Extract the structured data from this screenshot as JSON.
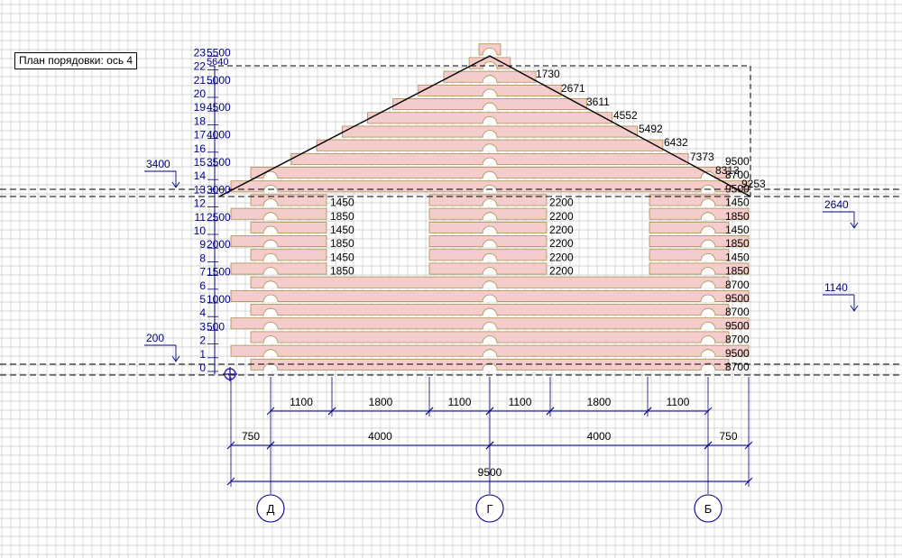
{
  "title": "План порядовки: ось 4",
  "colors": {
    "grid": "#c9c9c9",
    "log_fill": "#f5cccc",
    "log_stroke": "#a89050",
    "dim": "#000080",
    "roof": "#000000"
  },
  "row_numbers": [
    "0",
    "1",
    "2",
    "3",
    "4",
    "5",
    "6",
    "7",
    "8",
    "9",
    "10",
    "11",
    "12",
    "13",
    "14",
    "15",
    "16",
    "17",
    "18",
    "19",
    "20",
    "21",
    "22",
    "23"
  ],
  "height_marks": [
    "500",
    "1000",
    "1500",
    "2000",
    "2500",
    "3000",
    "3500",
    "4000",
    "4500",
    "5000",
    "5500"
  ],
  "top_mark": "5640",
  "roof_lengths": [
    "1730",
    "2671",
    "3611",
    "4552",
    "5492",
    "6432",
    "7373",
    "8313",
    "9253"
  ],
  "right_row_lengths": [
    "8700",
    "9500",
    "8700",
    "9500",
    "8700",
    "9500",
    "8700",
    "1850",
    "1450",
    "1850",
    "1450",
    "1850",
    "1450",
    "9500",
    "8700",
    "9500"
  ],
  "left_window_lengths": [
    "1850",
    "1450",
    "1850",
    "1450",
    "1850",
    "1450"
  ],
  "middle_lengths": [
    "2200",
    "2200",
    "2200",
    "2200",
    "2200",
    "2200"
  ],
  "side_levels": {
    "level_3400": "3400",
    "level_200": "200",
    "level_2640": "2640",
    "level_1140": "1140"
  },
  "dims": {
    "row1": [
      "1100",
      "1800",
      "1100",
      "1100",
      "1800",
      "1100"
    ],
    "row2": [
      "750",
      "4000",
      "4000",
      "750"
    ],
    "total": "9500"
  },
  "axes": [
    "Д",
    "Г",
    "Б"
  ]
}
